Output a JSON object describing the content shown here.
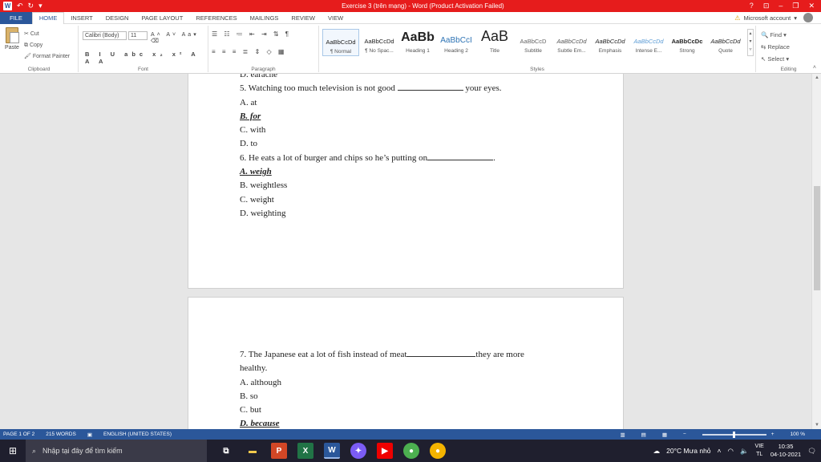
{
  "window": {
    "title": "Exercise 3 (trên mạng) - Word (Product Activation Failed)",
    "help": "?",
    "minimize": "–",
    "restore": "❐",
    "close": "✕"
  },
  "tabs": [
    "FILE",
    "HOME",
    "INSERT",
    "DESIGN",
    "PAGE LAYOUT",
    "REFERENCES",
    "MAILINGS",
    "REVIEW",
    "VIEW"
  ],
  "account": "Microsoft account",
  "ribbon": {
    "clipboard": {
      "paste": "Paste",
      "cut": "Cut",
      "copy": "Copy",
      "format_painter": "Format Painter",
      "label": "Clipboard"
    },
    "font": {
      "name": "Calibri (Body)",
      "size": "11",
      "label": "Font"
    },
    "paragraph": {
      "label": "Paragraph"
    },
    "styles": {
      "label": "Styles",
      "items": [
        {
          "preview": "AaBbCcDd",
          "name": "¶ Normal"
        },
        {
          "preview": "AaBbCcDd",
          "name": "¶ No Spac..."
        },
        {
          "preview": "AaBb",
          "name": "Heading 1"
        },
        {
          "preview": "AaBbCcI",
          "name": "Heading 2"
        },
        {
          "preview": "AaB",
          "name": "Title"
        },
        {
          "preview": "AaBbCcD",
          "name": "Subtitle"
        },
        {
          "preview": "AaBbCcDd",
          "name": "Subtle Em..."
        },
        {
          "preview": "AaBbCcDd",
          "name": "Emphasis"
        },
        {
          "preview": "AaBbCcDd",
          "name": "Intense E..."
        },
        {
          "preview": "AaBbCcDc",
          "name": "Strong"
        },
        {
          "preview": "AaBbCcDd",
          "name": "Quote"
        }
      ]
    },
    "editing": {
      "find": "Find",
      "replace": "Replace",
      "select": "Select",
      "label": "Editing"
    }
  },
  "document": {
    "page1_lines": [
      {
        "text": "D. earache",
        "answer": false
      },
      {
        "pre": "5. Watching too much television is not good ",
        "post": " your eyes.",
        "blank": true,
        "answer": false
      },
      {
        "text": "A. at",
        "answer": false
      },
      {
        "text": "B. for",
        "answer": true
      },
      {
        "text": "C. with",
        "answer": false
      },
      {
        "text": "D. to",
        "answer": false
      },
      {
        "pre": "6. He eats a lot of burger and chips so he’s putting on",
        "post": ".",
        "blank": true,
        "answer": false
      },
      {
        "text": "A. weigh",
        "answer": true
      },
      {
        "text": "B. weightless",
        "answer": false
      },
      {
        "text": "C. weight",
        "answer": false
      },
      {
        "text": "D. weighting",
        "answer": false
      }
    ],
    "page2_lines": [
      {
        "pre": "7. The Japanese eat a lot of fish instead of meat",
        "post": "they are more",
        "blank": true,
        "answer": false
      },
      {
        "text": "healthy.",
        "answer": false
      },
      {
        "text": "A. although",
        "answer": false
      },
      {
        "text": "B. so",
        "answer": false
      },
      {
        "text": "C. but",
        "answer": false
      },
      {
        "text": "D. because",
        "answer": true
      }
    ]
  },
  "status": {
    "page": "PAGE 1 OF 2",
    "words": "215 WORDS",
    "language": "ENGLISH (UNITED STATES)",
    "zoom": "100 %"
  },
  "taskbar": {
    "search_placeholder": "Nhập tại đây để tìm kiếm",
    "weather": "20°C Mưa nhỏ",
    "lang_top": "VIE",
    "lang_bottom": "TL",
    "time": "10:35",
    "date": "04-10-2021"
  },
  "colors": {
    "title_bar": "#e61c1c",
    "word_blue": "#2b579a"
  }
}
